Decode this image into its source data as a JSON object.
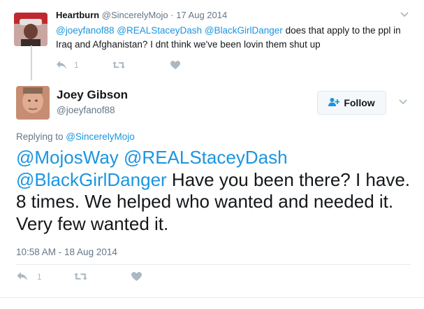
{
  "parent_tweet": {
    "name": "Heartburn",
    "handle": "@SincerelyMojo",
    "separator": "·",
    "date": "17 Aug 2014",
    "text_parts": {
      "m1": "@joeyfanof88",
      "m2": "@REALStaceyDash",
      "m3": "@BlackGirlDanger",
      "body": " does that apply to the ppl in Iraq and Afghanistan? I dnt think we've been lovin them shut up"
    },
    "reply_count": "1",
    "icons": [
      "reply-icon",
      "retweet-icon",
      "like-icon",
      "chevron-down-icon"
    ]
  },
  "main_tweet": {
    "name": "Joey Gibson",
    "handle": "@joeyfanof88",
    "follow_label": "Follow",
    "replying_prefix": "Replying to ",
    "replying_to": "@SincerelyMojo",
    "text_parts": {
      "m1": "@MojosWay",
      "m2": "@REALStaceyDash",
      "m3": "@BlackGirlDanger",
      "body": " Have you been there? I have. 8 times. We helped who wanted and needed it. Very few wanted it."
    },
    "timestamp": "10:58 AM - 18 Aug 2014",
    "reply_count": "1",
    "icons": [
      "reply-icon",
      "retweet-icon",
      "like-icon",
      "follow-user-icon",
      "chevron-down-icon"
    ]
  },
  "colors": {
    "link": "#1b95e0",
    "text": "#14171a",
    "muted": "#657786",
    "icon": "#aab8c2",
    "border": "#e1e8ed"
  }
}
